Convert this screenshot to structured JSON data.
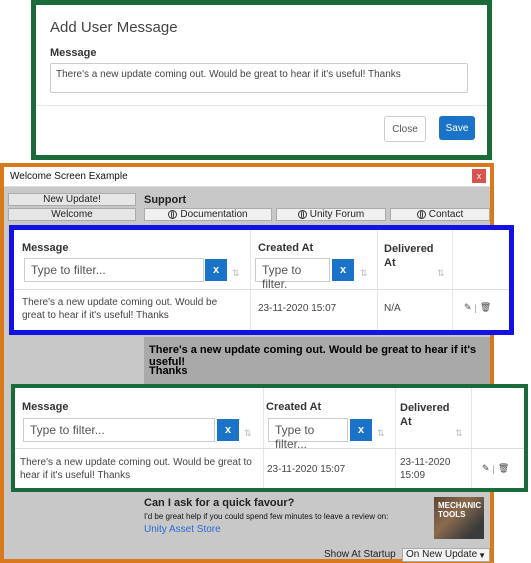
{
  "dialog": {
    "title": "Add User Message",
    "message_label": "Message",
    "message_value": "There's a new update coming out. Would be great to hear if it's useful! Thanks",
    "close_label": "Close",
    "save_label": "Save"
  },
  "window": {
    "title": "Welcome Screen Example",
    "close_glyph": "x",
    "nav": [
      "New Update!",
      "Welcome"
    ],
    "section_title": "Support",
    "links": [
      "Documentation",
      "Unity Forum",
      "Contact"
    ],
    "message_lines": [
      "There's a new update coming out. Would be great to hear if it's useful!",
      "Thanks"
    ],
    "favour_title": "Can I ask for a quick favour?",
    "favour_text": "I'd be great help if you could spend few minutes to leave a review on:",
    "favour_link": "Unity Asset Store",
    "logo_lines": [
      "MECHANIC",
      "TOOLS"
    ],
    "show_at_startup_label": "Show At Startup",
    "show_at_startup_value": "On New Update"
  },
  "table_blue": {
    "col_message": "Message",
    "col_created": "Created At",
    "col_delivered": "Delivered At",
    "filter_placeholder_message": "Type to filter...",
    "filter_placeholder_created": "Type to filter.",
    "clear_glyph": "x",
    "row": {
      "message": "There's a new update coming out. Would be great to hear if it's useful! Thanks",
      "created": "23-11-2020 15:07",
      "delivered": "N/A"
    }
  },
  "table_green": {
    "col_message": "Message",
    "col_created": "Created At",
    "col_delivered": "Delivered At",
    "filter_placeholder_message": "Type to filter...",
    "filter_placeholder_created": "Type to filter...",
    "clear_glyph": "x",
    "row": {
      "message": "There's a new update coming out. Would be great to hear if it's useful! Thanks",
      "created": "23-11-2020 15:07",
      "delivered": "23-11-2020 15:09"
    }
  },
  "colors": {
    "accent": "#1a73c9",
    "dialog_border": "#1b6b3a",
    "window_border": "#d9791c",
    "blue_box": "#1212e6",
    "green_box": "#1b6b3a"
  }
}
